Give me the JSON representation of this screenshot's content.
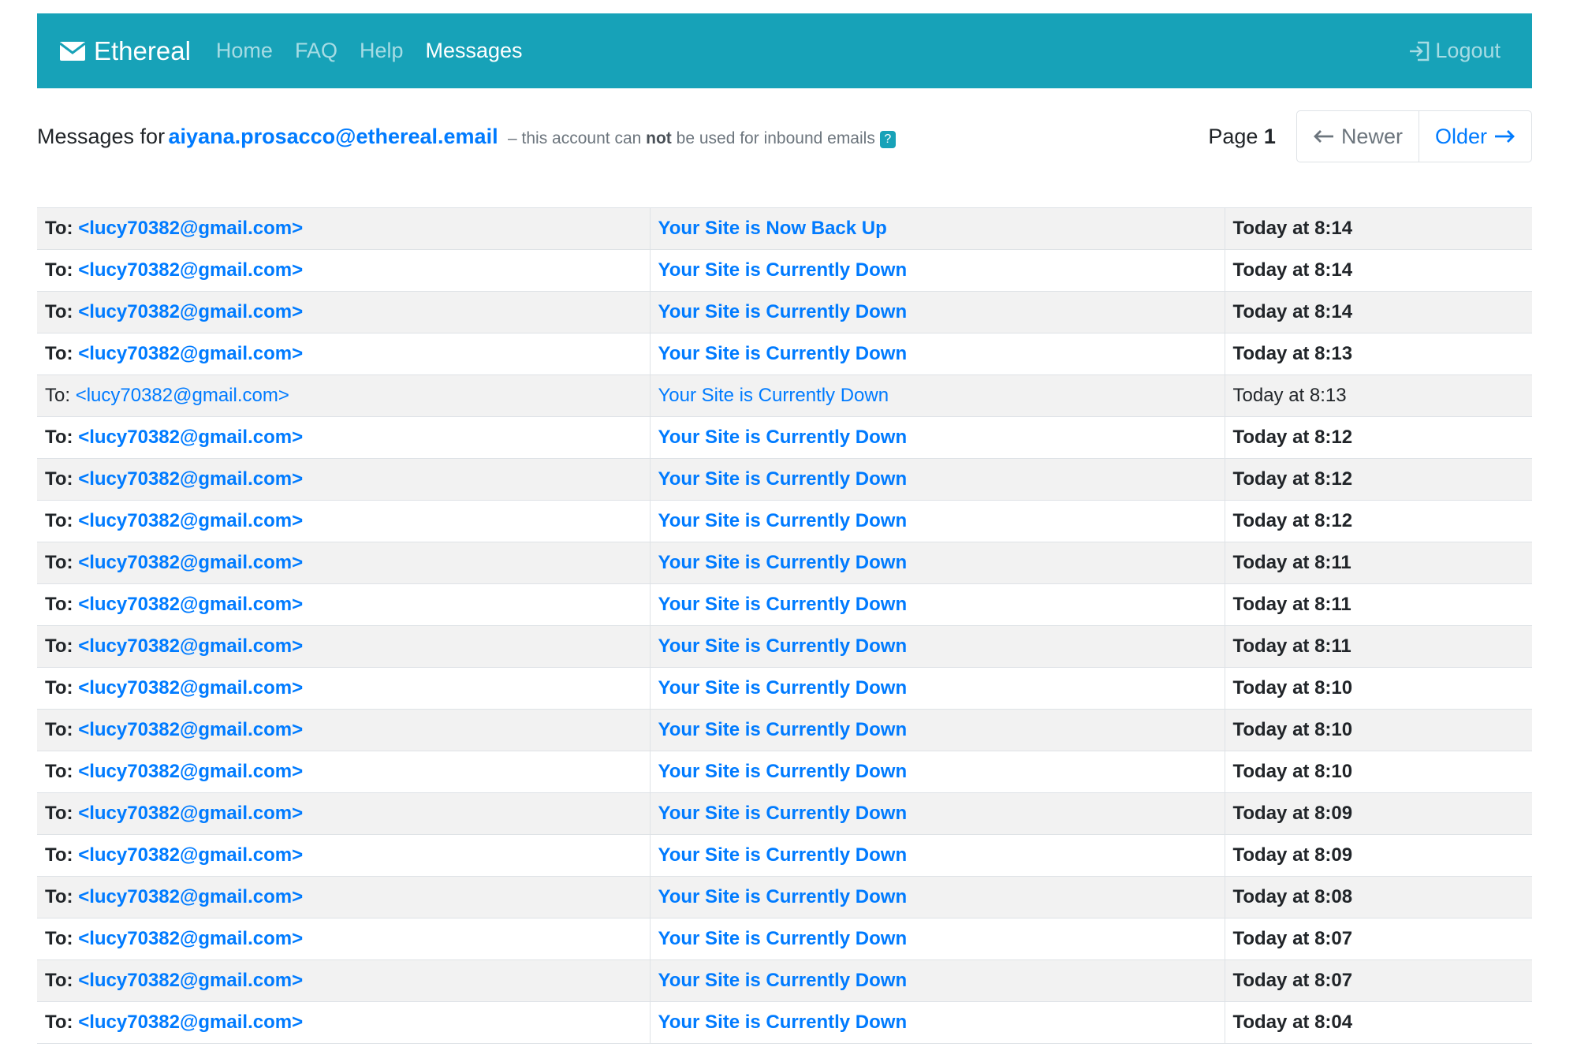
{
  "nav": {
    "brand": "Ethereal",
    "links": [
      "Home",
      "FAQ",
      "Help",
      "Messages"
    ],
    "active": "Messages",
    "logout": "Logout"
  },
  "header": {
    "prefix": "Messages for",
    "account": "aiyana.prosacco@ethereal.email",
    "note_start": "– this account can",
    "note_bold": "not",
    "note_end": "be used for inbound emails",
    "info_icon": "question-icon"
  },
  "pager": {
    "page_label": "Page",
    "page_number": "1",
    "newer": "Newer",
    "older": "Older"
  },
  "colors": {
    "navbar": "#17a2b8",
    "link": "#007bff",
    "stripe": "#f2f2f2"
  },
  "messages": [
    {
      "to_label": "To:",
      "to": "<lucy70382@gmail.com>",
      "subject": "Your Site is Now Back Up",
      "date": "Today at 8:14",
      "unread": true
    },
    {
      "to_label": "To:",
      "to": "<lucy70382@gmail.com>",
      "subject": "Your Site is Currently Down",
      "date": "Today at 8:14",
      "unread": true
    },
    {
      "to_label": "To:",
      "to": "<lucy70382@gmail.com>",
      "subject": "Your Site is Currently Down",
      "date": "Today at 8:14",
      "unread": true
    },
    {
      "to_label": "To:",
      "to": "<lucy70382@gmail.com>",
      "subject": "Your Site is Currently Down",
      "date": "Today at 8:13",
      "unread": true
    },
    {
      "to_label": "To:",
      "to": "<lucy70382@gmail.com>",
      "subject": "Your Site is Currently Down",
      "date": "Today at 8:13",
      "unread": false
    },
    {
      "to_label": "To:",
      "to": "<lucy70382@gmail.com>",
      "subject": "Your Site is Currently Down",
      "date": "Today at 8:12",
      "unread": true
    },
    {
      "to_label": "To:",
      "to": "<lucy70382@gmail.com>",
      "subject": "Your Site is Currently Down",
      "date": "Today at 8:12",
      "unread": true
    },
    {
      "to_label": "To:",
      "to": "<lucy70382@gmail.com>",
      "subject": "Your Site is Currently Down",
      "date": "Today at 8:12",
      "unread": true
    },
    {
      "to_label": "To:",
      "to": "<lucy70382@gmail.com>",
      "subject": "Your Site is Currently Down",
      "date": "Today at 8:11",
      "unread": true
    },
    {
      "to_label": "To:",
      "to": "<lucy70382@gmail.com>",
      "subject": "Your Site is Currently Down",
      "date": "Today at 8:11",
      "unread": true
    },
    {
      "to_label": "To:",
      "to": "<lucy70382@gmail.com>",
      "subject": "Your Site is Currently Down",
      "date": "Today at 8:11",
      "unread": true
    },
    {
      "to_label": "To:",
      "to": "<lucy70382@gmail.com>",
      "subject": "Your Site is Currently Down",
      "date": "Today at 8:10",
      "unread": true
    },
    {
      "to_label": "To:",
      "to": "<lucy70382@gmail.com>",
      "subject": "Your Site is Currently Down",
      "date": "Today at 8:10",
      "unread": true
    },
    {
      "to_label": "To:",
      "to": "<lucy70382@gmail.com>",
      "subject": "Your Site is Currently Down",
      "date": "Today at 8:10",
      "unread": true
    },
    {
      "to_label": "To:",
      "to": "<lucy70382@gmail.com>",
      "subject": "Your Site is Currently Down",
      "date": "Today at 8:09",
      "unread": true
    },
    {
      "to_label": "To:",
      "to": "<lucy70382@gmail.com>",
      "subject": "Your Site is Currently Down",
      "date": "Today at 8:09",
      "unread": true
    },
    {
      "to_label": "To:",
      "to": "<lucy70382@gmail.com>",
      "subject": "Your Site is Currently Down",
      "date": "Today at 8:08",
      "unread": true
    },
    {
      "to_label": "To:",
      "to": "<lucy70382@gmail.com>",
      "subject": "Your Site is Currently Down",
      "date": "Today at 8:07",
      "unread": true
    },
    {
      "to_label": "To:",
      "to": "<lucy70382@gmail.com>",
      "subject": "Your Site is Currently Down",
      "date": "Today at 8:07",
      "unread": true
    },
    {
      "to_label": "To:",
      "to": "<lucy70382@gmail.com>",
      "subject": "Your Site is Currently Down",
      "date": "Today at 8:04",
      "unread": true
    }
  ]
}
